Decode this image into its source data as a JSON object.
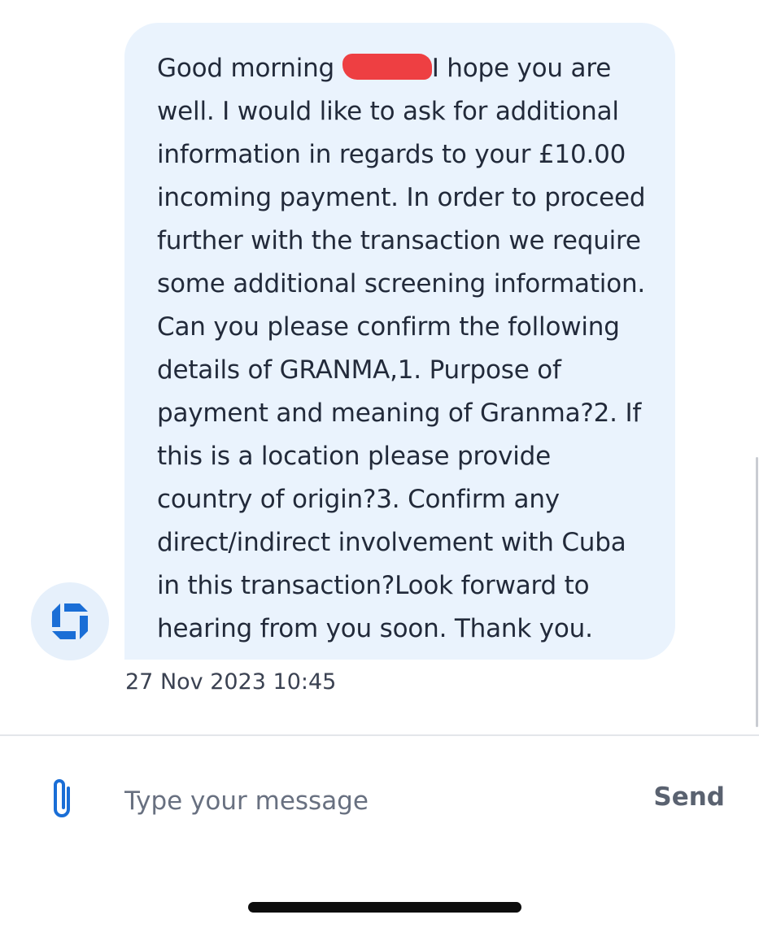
{
  "conversation": {
    "message": {
      "text_before_redaction": "Good morning ",
      "text_after_redaction": "I hope you are well. I would like to ask for additional information in regards to your £10.00 incoming payment. In order to proceed further with the transaction we require some additional screening information. Can you please confirm the following details of GRANMA,1. Purpose of payment and meaning of Granma?2. If this is a location please provide country of origin?3. Confirm any direct/indirect involvement with Cuba in this transaction?Look forward to hearing from you soon. Thank you.",
      "timestamp": "27 Nov 2023 10:45",
      "sender_avatar_icon": "bank-logo-icon",
      "redaction_color": "#ee3f42"
    }
  },
  "composer": {
    "attach_icon": "paperclip-icon",
    "placeholder": "Type your message",
    "value": "",
    "send_label": "Send"
  },
  "colors": {
    "accent": "#1a6ed6",
    "bubble_background": "#eaf3fd"
  }
}
